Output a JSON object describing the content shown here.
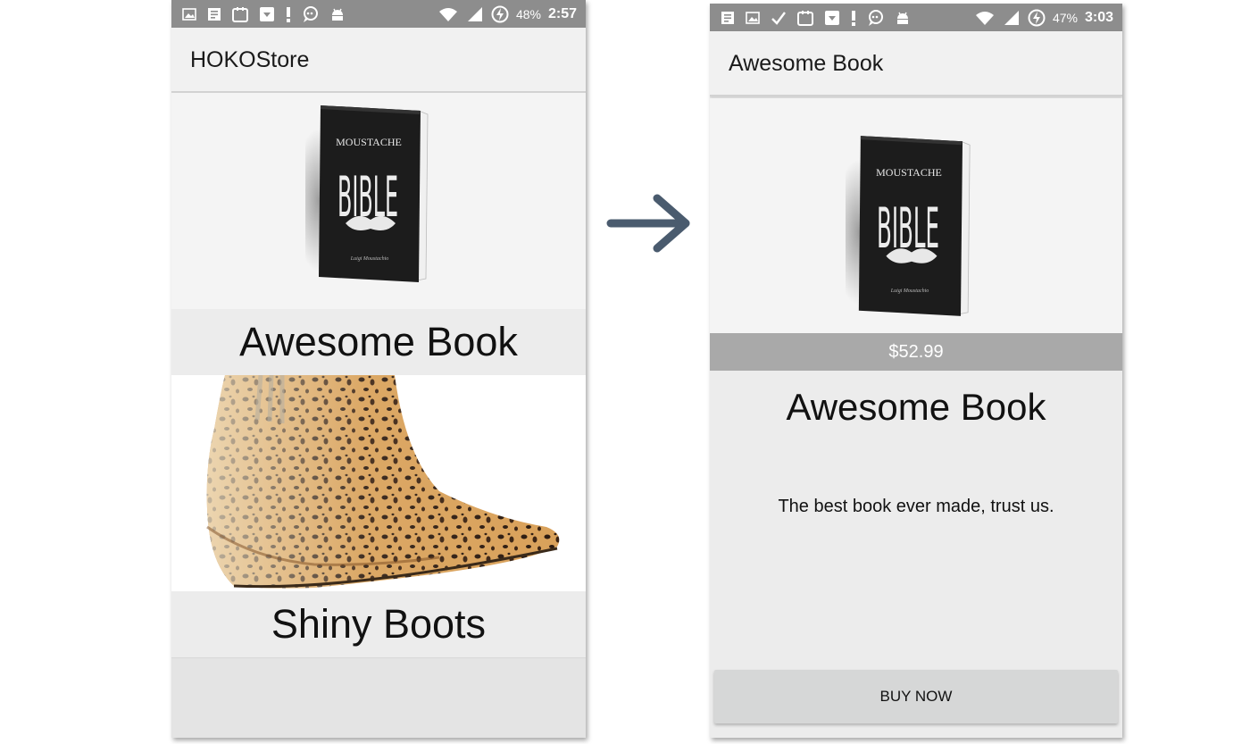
{
  "left_screen": {
    "status": {
      "battery": "48%",
      "time": "2:57"
    },
    "app_title": "HOKOStore",
    "products": [
      {
        "name": "Awesome Book",
        "image": "book-image",
        "book_cover": {
          "line1": "MOUSTACHE",
          "line2": "BIBLE",
          "author": "Luigi Moustachio"
        }
      },
      {
        "name": "Shiny Boots",
        "image": "boot-image"
      }
    ]
  },
  "arrow_icon": "right-arrow-icon",
  "right_screen": {
    "status": {
      "battery": "47%",
      "time": "3:03"
    },
    "app_title": "Awesome Book",
    "book_cover": {
      "line1": "MOUSTACHE",
      "line2": "BIBLE",
      "author": "Luigi Moustachio"
    },
    "price": "$52.99",
    "product_name": "Awesome Book",
    "description": "The best book ever made, trust us.",
    "buy_label": "BUY NOW"
  },
  "colors": {
    "status_bar": "#8d8d8d",
    "app_bar": "#f1f1f1",
    "price_bar": "#a9a9a9",
    "arrow": "#4a5b6e",
    "button": "#d6d7d7"
  }
}
